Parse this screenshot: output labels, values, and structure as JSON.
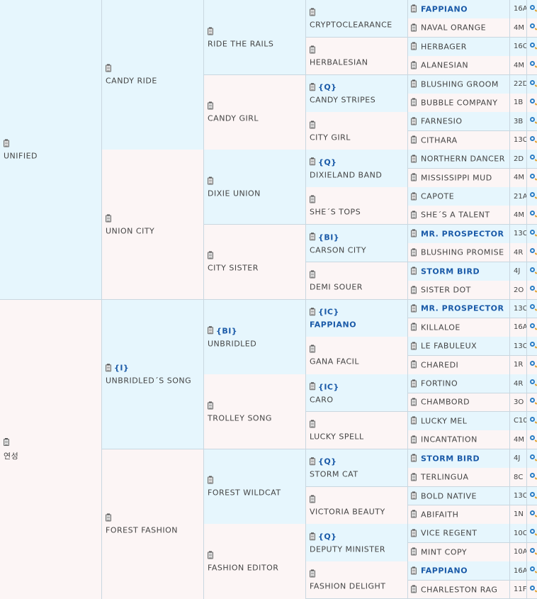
{
  "gen1": [
    {
      "name": "UNIFIED",
      "tag": ""
    },
    {
      "name": "연성",
      "tag": ""
    }
  ],
  "gen2": [
    {
      "name": "CANDY RIDE",
      "tag": ""
    },
    {
      "name": "UNION CITY",
      "tag": ""
    },
    {
      "name": "UNBRIDLED´S SONG",
      "tag": "{I}"
    },
    {
      "name": "FOREST FASHION",
      "tag": ""
    }
  ],
  "gen3": [
    {
      "name": "RIDE THE RAILS",
      "tag": ""
    },
    {
      "name": "CANDY GIRL",
      "tag": ""
    },
    {
      "name": "DIXIE UNION",
      "tag": ""
    },
    {
      "name": "CITY SISTER",
      "tag": ""
    },
    {
      "name": "UNBRIDLED",
      "tag": "{BI}"
    },
    {
      "name": "TROLLEY SONG",
      "tag": ""
    },
    {
      "name": "FOREST WILDCAT",
      "tag": ""
    },
    {
      "name": "FASHION EDITOR",
      "tag": ""
    }
  ],
  "gen4": [
    {
      "name": "CRYPTOCLEARANCE",
      "tag": "",
      "bold": false
    },
    {
      "name": "HERBALESIAN",
      "tag": "",
      "bold": false
    },
    {
      "name": "CANDY STRIPES",
      "tag": "{Q}",
      "bold": false
    },
    {
      "name": "CITY GIRL",
      "tag": "",
      "bold": false
    },
    {
      "name": "DIXIELAND BAND",
      "tag": "{Q}",
      "bold": false
    },
    {
      "name": "SHE´S TOPS",
      "tag": "",
      "bold": false
    },
    {
      "name": "CARSON CITY",
      "tag": "{BI}",
      "bold": false
    },
    {
      "name": "DEMI SOUER",
      "tag": "",
      "bold": false
    },
    {
      "name": "FAPPIANO",
      "tag": "{IC}",
      "bold": true
    },
    {
      "name": "GANA FACIL",
      "tag": "",
      "bold": false
    },
    {
      "name": "CARO",
      "tag": "{IC}",
      "bold": false
    },
    {
      "name": "LUCKY SPELL",
      "tag": "",
      "bold": false
    },
    {
      "name": "STORM CAT",
      "tag": "{Q}",
      "bold": false
    },
    {
      "name": "VICTORIA BEAUTY",
      "tag": "",
      "bold": false
    },
    {
      "name": "DEPUTY MINISTER",
      "tag": "{Q}",
      "bold": false
    },
    {
      "name": "FASHION DELIGHT",
      "tag": "",
      "bold": false
    }
  ],
  "gen5": [
    {
      "name": "FAPPIANO",
      "code": "16A",
      "bold": true
    },
    {
      "name": "NAVAL ORANGE",
      "code": "4M",
      "bold": false
    },
    {
      "name": "HERBAGER",
      "code": "16C",
      "bold": false
    },
    {
      "name": "ALANESIAN",
      "code": "4M",
      "bold": false
    },
    {
      "name": "BLUSHING GROOM",
      "code": "22D",
      "bold": false
    },
    {
      "name": "BUBBLE COMPANY",
      "code": "1B",
      "bold": false
    },
    {
      "name": "FARNESIO",
      "code": "3B",
      "bold": false
    },
    {
      "name": "CITHARA",
      "code": "13C",
      "bold": false
    },
    {
      "name": "NORTHERN DANCER",
      "code": "2D",
      "bold": false
    },
    {
      "name": "MISSISSIPPI MUD",
      "code": "4M",
      "bold": false
    },
    {
      "name": "CAPOTE",
      "code": "21A",
      "bold": false
    },
    {
      "name": "SHE´S A TALENT",
      "code": "4M",
      "bold": false
    },
    {
      "name": "MR. PROSPECTOR",
      "code": "13C",
      "bold": true
    },
    {
      "name": "BLUSHING PROMISE",
      "code": "4R",
      "bold": false
    },
    {
      "name": "STORM BIRD",
      "code": "4J",
      "bold": true
    },
    {
      "name": "SISTER DOT",
      "code": "2O",
      "bold": false
    },
    {
      "name": "MR. PROSPECTOR",
      "code": "13C",
      "bold": true
    },
    {
      "name": "KILLALOE",
      "code": "16A",
      "bold": false
    },
    {
      "name": "LE FABULEUX",
      "code": "13C",
      "bold": false
    },
    {
      "name": "CHAREDI",
      "code": "1R",
      "bold": false
    },
    {
      "name": "FORTINO",
      "code": "4R",
      "bold": false
    },
    {
      "name": "CHAMBORD",
      "code": "3O",
      "bold": false
    },
    {
      "name": "LUCKY MEL",
      "code": "C10",
      "bold": false
    },
    {
      "name": "INCANTATION",
      "code": "4M",
      "bold": false
    },
    {
      "name": "STORM BIRD",
      "code": "4J",
      "bold": true
    },
    {
      "name": "TERLINGUA",
      "code": "8C",
      "bold": false
    },
    {
      "name": "BOLD NATIVE",
      "code": "13C",
      "bold": false
    },
    {
      "name": "ABIFAITH",
      "code": "1N",
      "bold": false
    },
    {
      "name": "VICE REGENT",
      "code": "10C",
      "bold": false
    },
    {
      "name": "MINT COPY",
      "code": "10A",
      "bold": false
    },
    {
      "name": "FAPPIANO",
      "code": "16A",
      "bold": true
    },
    {
      "name": "CHARLESTON RAG",
      "code": "11F",
      "bold": false
    }
  ]
}
